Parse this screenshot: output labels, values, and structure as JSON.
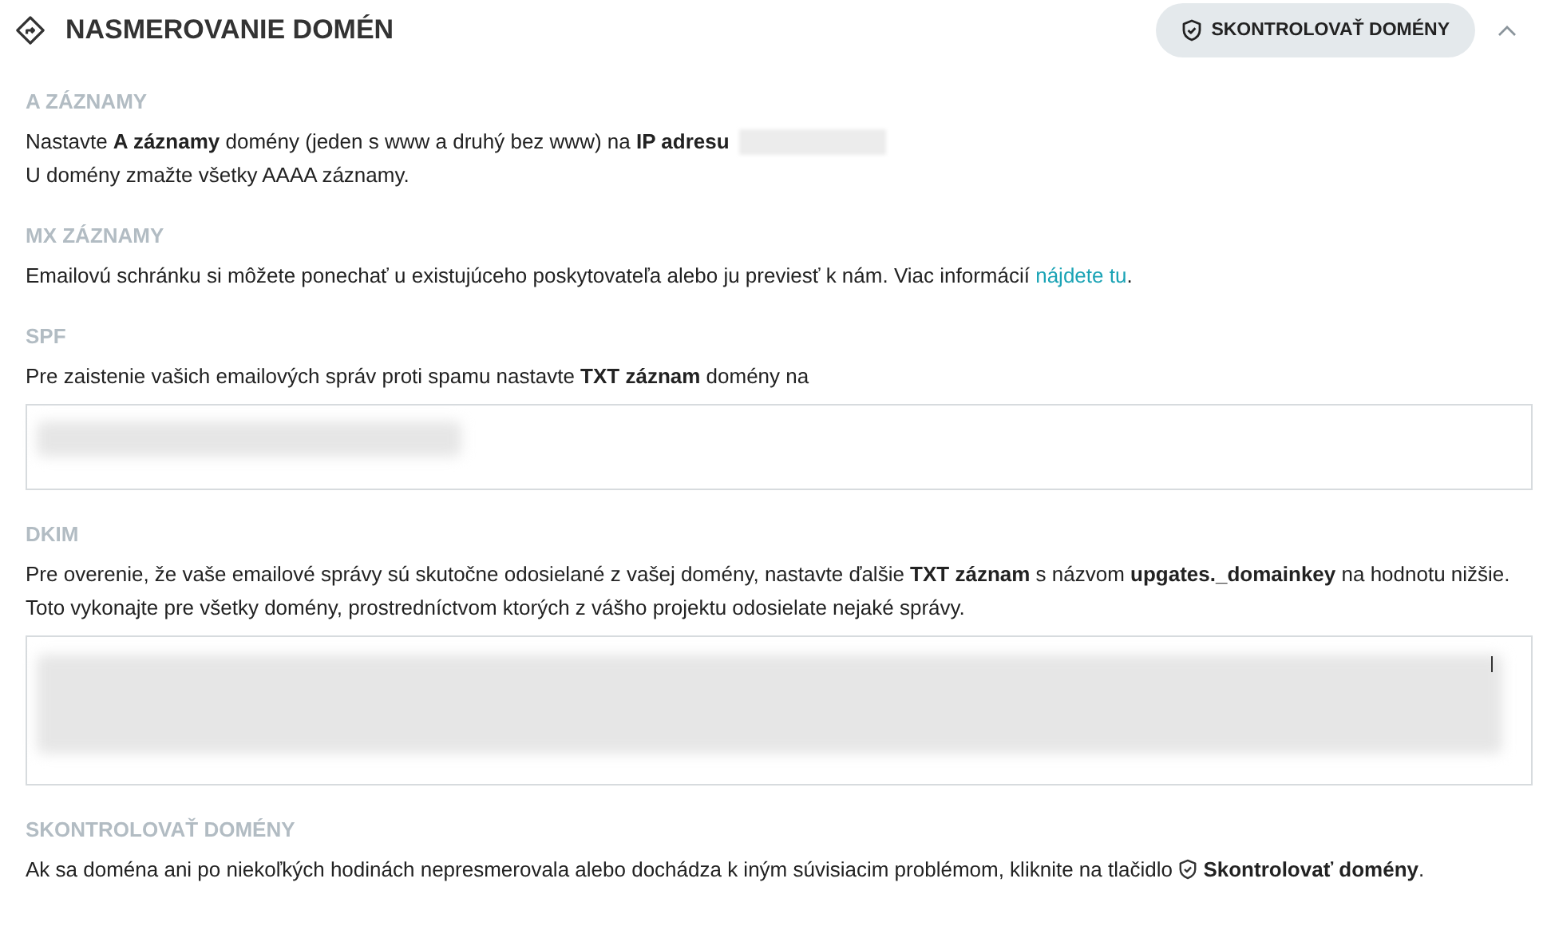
{
  "header": {
    "title": "NASMEROVANIE DOMÉN",
    "check_button": "SKONTROLOVAŤ DOMÉNY",
    "expanded": true
  },
  "sections": [
    {
      "kind": "note",
      "heading": "A ZÁZNAMY",
      "paragraphs": [
        {
          "kind": "redacted",
          "text": "Nastavte **A záznamy** domény (jeden s www a druhý bez www) na **IP adresu**"
        },
        {
          "kind": "plain",
          "text": "U domény zmažte všetky AAAA záznamy."
        }
      ]
    },
    {
      "kind": "note",
      "heading": "MX ZÁZNAMY",
      "paragraphs": [
        {
          "kind": "link",
          "text": "Emailovú schránku si môžete ponechať u existujúceho poskytovateľa alebo ju previesť k nám. Viac informácií",
          "link": "nájdete tu",
          "after": "."
        }
      ]
    },
    {
      "kind": "field",
      "heading": "SPF",
      "paragraphs": [
        {
          "kind": "plain",
          "text": "Pre zaistenie vašich emailových správ proti spamu nastavte **TXT záznam** domény na"
        }
      ]
    },
    {
      "kind": "widefield",
      "heading": "DKIM",
      "paragraphs": [
        {
          "kind": "plain",
          "text": "Pre overenie, že vaše emailové správy sú skutočne odosielané z vašej domény, nastavte ďalšie **TXT záznam** s názvom **upgates._domainkey** na hodnotu nižšie. Toto vykonajte pre všetky domény, prostredníctvom ktorých z vášho projektu odosielate nejaké správy."
        }
      ]
    },
    {
      "kind": "note",
      "heading": "SKONTROLOVAŤ DOMÉNY",
      "paragraphs": [
        {
          "kind": "reference",
          "text": "Ak sa doména ani po niekoľkých hodinách nepresmerovala alebo dochádza k iným súvisiacim problémom, kliknite na tlačidlo",
          "bold_text": "Skontrolovať domény",
          "after": "."
        }
      ]
    }
  ]
}
